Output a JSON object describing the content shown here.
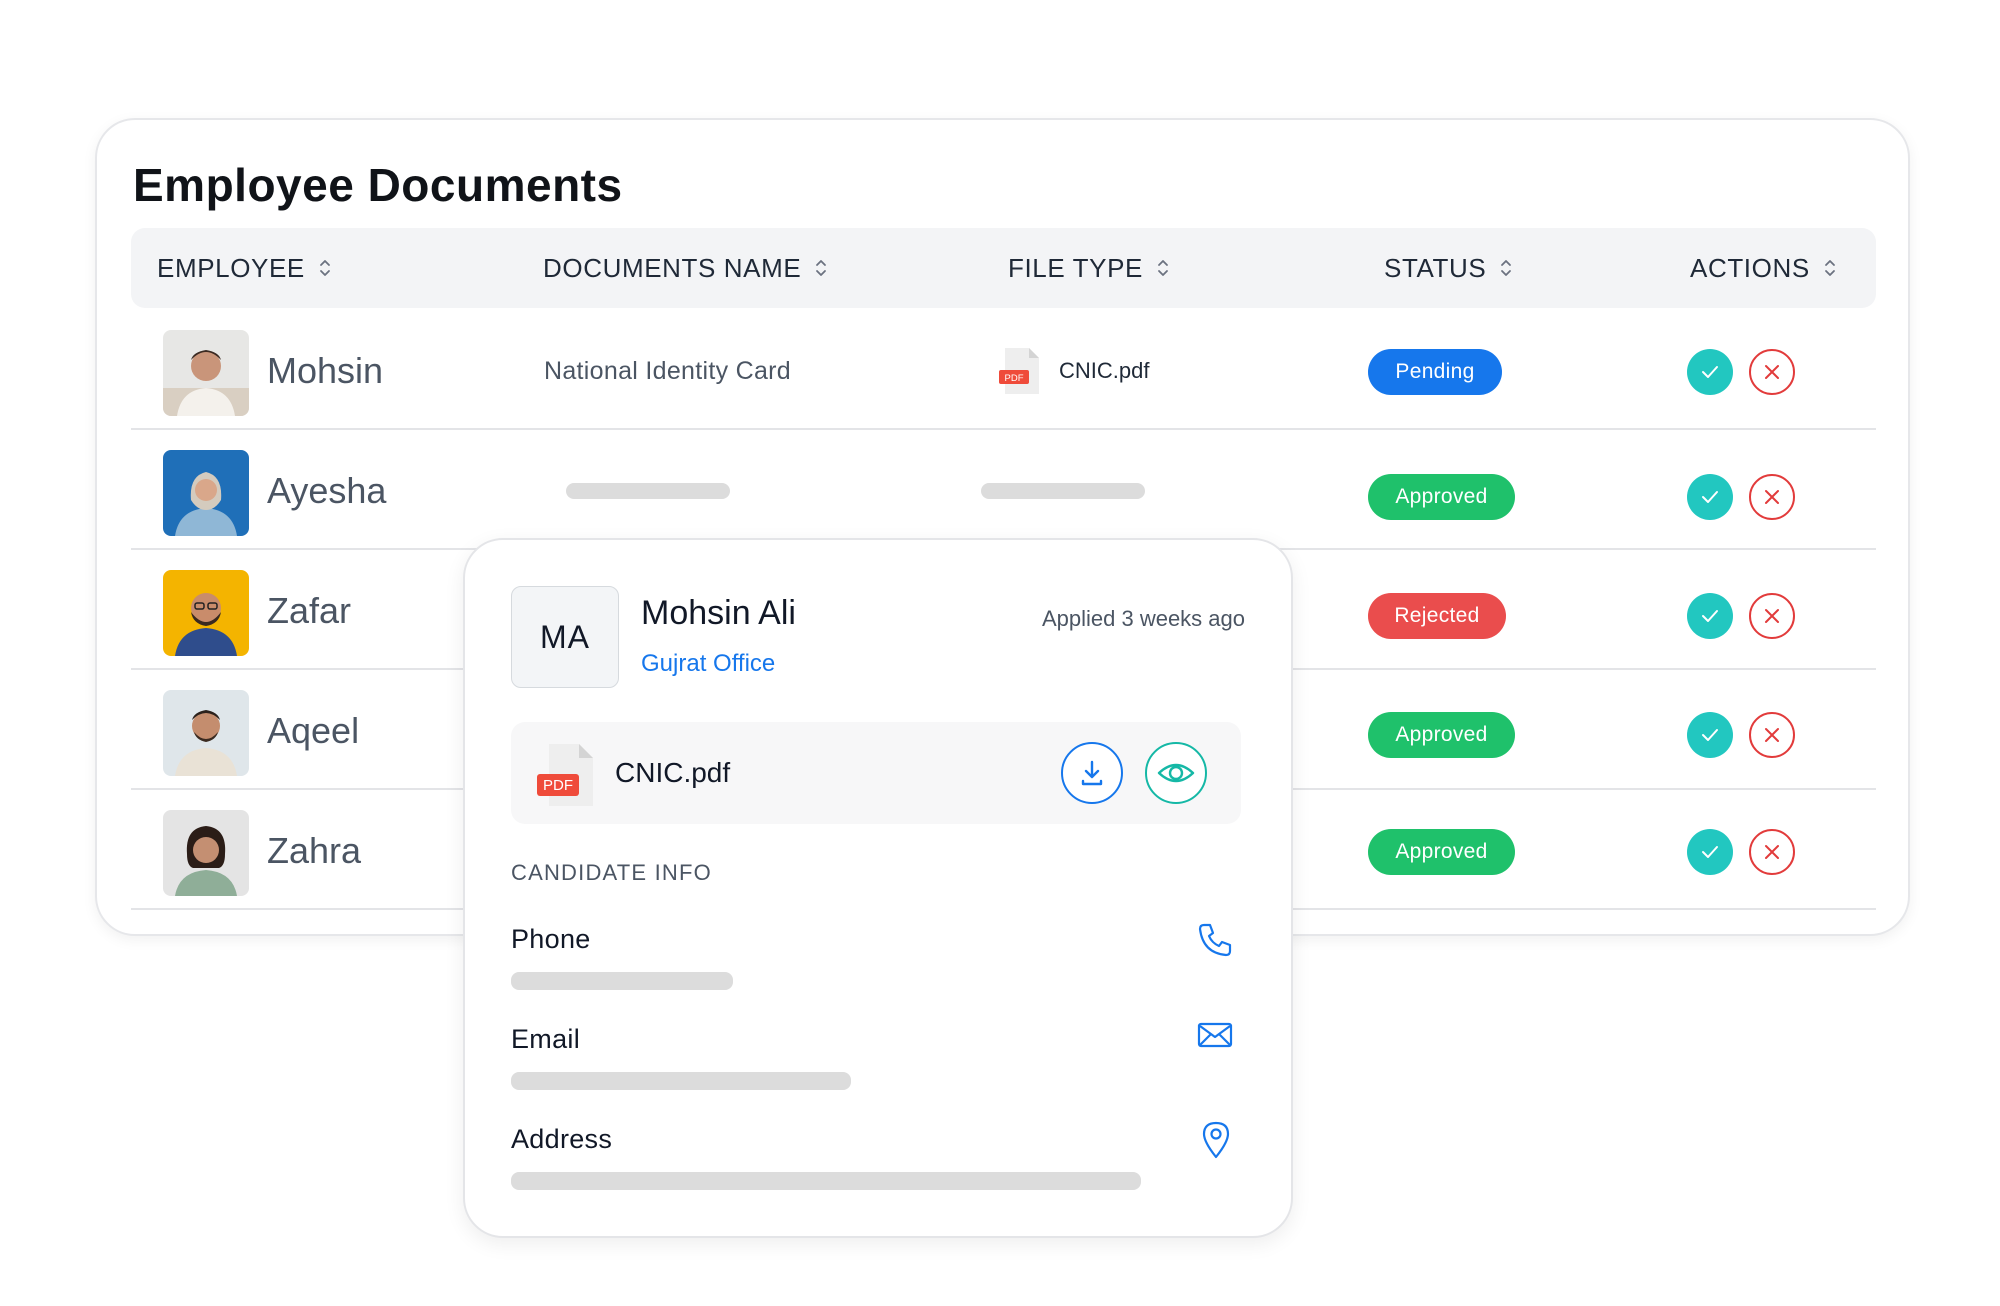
{
  "page": {
    "title": "Employee Documents"
  },
  "columns": [
    {
      "label": "EMPLOYEE"
    },
    {
      "label": "DOCUMENTS NAME"
    },
    {
      "label": "FILE TYPE"
    },
    {
      "label": "STATUS"
    },
    {
      "label": "ACTIONS"
    }
  ],
  "rows": [
    {
      "name": "Mohsin",
      "document": "National Identity Card",
      "file": "CNIC.pdf",
      "file_badge": "PDF",
      "status": "Pending"
    },
    {
      "name": "Ayesha",
      "document": "",
      "file": "",
      "status": "Approved"
    },
    {
      "name": "Zafar",
      "document": "",
      "file": "",
      "status": "Rejected"
    },
    {
      "name": "Aqeel",
      "document": "",
      "file": "",
      "status": "Approved"
    },
    {
      "name": "Zahra",
      "document": "",
      "file": "",
      "status": "Approved"
    }
  ],
  "popup": {
    "initials": "MA",
    "name": "Mohsin Ali",
    "office": "Gujrat Office",
    "applied": "Applied 3 weeks ago",
    "file_name": "CNIC.pdf",
    "file_badge": "PDF",
    "section_title": "CANDIDATE INFO",
    "fields": [
      {
        "label": "Phone",
        "icon": "phone-icon"
      },
      {
        "label": "Email",
        "icon": "mail-icon"
      },
      {
        "label": "Address",
        "icon": "location-pin-icon"
      }
    ]
  },
  "colors": {
    "pending": "#1677ec",
    "approved": "#1fc16b",
    "rejected": "#ea4d4d",
    "approve_action": "#22c7c0",
    "reject_action": "#e23b3b",
    "link": "#1677ec"
  }
}
